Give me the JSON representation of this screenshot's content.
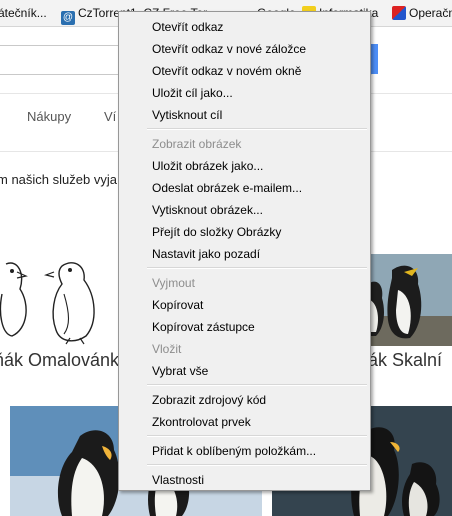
{
  "favorites": [
    {
      "label": "átečník...",
      "icon": "bookmark-icon"
    },
    {
      "label": "CzTorrent",
      "icon": "cztorrent-icon"
    },
    {
      "label": "1. CZ Free Tor...",
      "icon": "torrent-icon"
    },
    {
      "label": "Google",
      "icon": "google-icon"
    },
    {
      "label": "Informatika",
      "icon": "crown-icon"
    },
    {
      "label": "Operačn",
      "icon": "flag-icon"
    }
  ],
  "nav": {
    "shopping": "Nákupy",
    "more": "Ví"
  },
  "notice": "m našich služeb vyja",
  "captions": {
    "left": "ňák Omalovánk",
    "right": "ák Skalní"
  },
  "context_menu": {
    "items": [
      {
        "label": "Otevřít odkaz",
        "disabled": false
      },
      {
        "label": "Otevřít odkaz v nové záložce",
        "disabled": false
      },
      {
        "label": "Otevřít odkaz v novém okně",
        "disabled": false
      },
      {
        "label": "Uložit cíl jako...",
        "disabled": false
      },
      {
        "label": "Vytisknout cíl",
        "disabled": false
      },
      {
        "label": "Zobrazit obrázek",
        "disabled": true
      },
      {
        "label": "Uložit obrázek jako...",
        "disabled": false
      },
      {
        "label": "Odeslat obrázek e-mailem...",
        "disabled": false
      },
      {
        "label": "Vytisknout obrázek...",
        "disabled": false
      },
      {
        "label": "Přejít do složky Obrázky",
        "disabled": false
      },
      {
        "label": "Nastavit jako pozadí",
        "disabled": false
      },
      {
        "label": "Vyjmout",
        "disabled": true
      },
      {
        "label": "Kopírovat",
        "disabled": false
      },
      {
        "label": "Kopírovat zástupce",
        "disabled": false
      },
      {
        "label": "Vložit",
        "disabled": true
      },
      {
        "label": "Vybrat vše",
        "disabled": false
      },
      {
        "label": "Zobrazit zdrojový kód",
        "disabled": false
      },
      {
        "label": "Zkontrolovat prvek",
        "disabled": false
      },
      {
        "label": "Přidat k oblíbeným položkám...",
        "disabled": false
      },
      {
        "label": "Vlastnosti",
        "disabled": false
      }
    ]
  },
  "colors": {
    "search_button": "#4d8ef6",
    "menu_bg": "#f0f0f0",
    "disabled_text": "#8d8d8d"
  }
}
